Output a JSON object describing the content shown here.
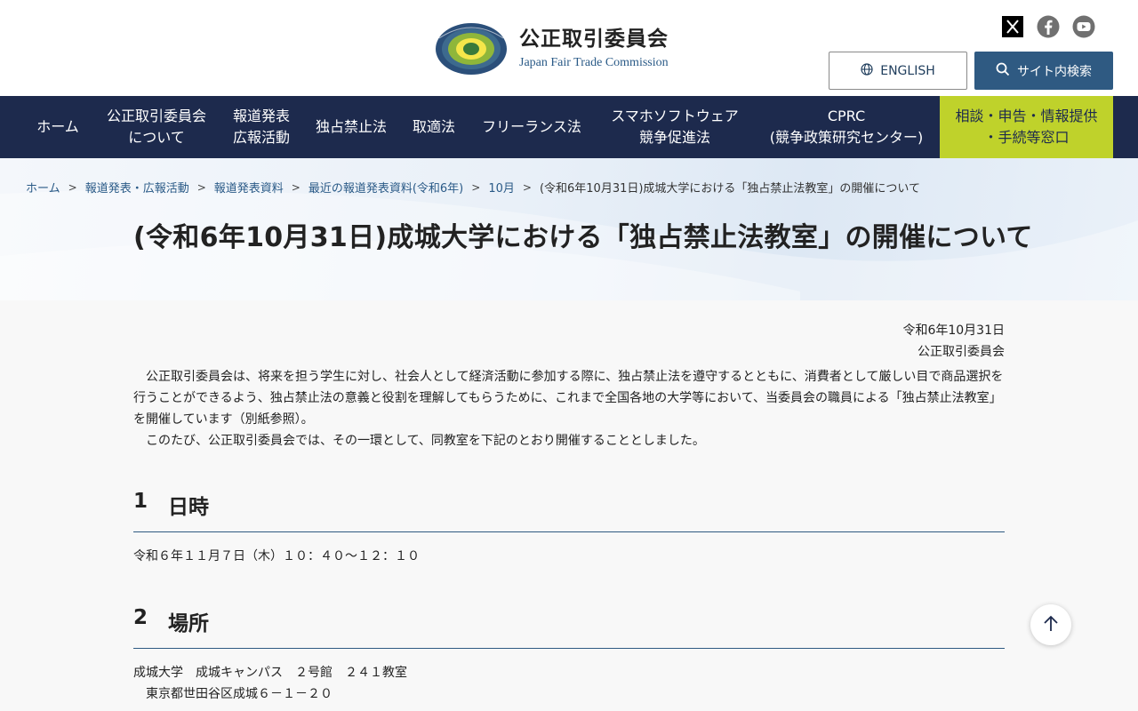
{
  "header": {
    "site_name_ja": "公正取引委員会",
    "site_name_en": "Japan Fair Trade Commission",
    "english_button": "ENGLISH",
    "search_button": "サイト内検索",
    "social": [
      "x-icon",
      "facebook-icon",
      "youtube-icon"
    ]
  },
  "nav": {
    "items": [
      {
        "label": "ホーム"
      },
      {
        "label": "公正取引委員会\nについて"
      },
      {
        "label": "報道発表\n広報活動"
      },
      {
        "label": "独占禁止法"
      },
      {
        "label": "取適法"
      },
      {
        "label": "フリーランス法"
      },
      {
        "label": "スマホソフトウェア\n競争促進法"
      },
      {
        "label": "CPRC\n(競争政策研究センター)"
      },
      {
        "label": "相談・申告・情報提供\n・手続等窓口"
      }
    ]
  },
  "breadcrumb": {
    "items": [
      "ホーム",
      "報道発表・広報活動",
      "報道発表資料",
      "最近の報道発表資料(令和6年)",
      "10月"
    ],
    "current": "(令和6年10月31日)成城大学における「独占禁止法教室」の開催について",
    "separator": ">"
  },
  "page": {
    "title": "(令和6年10月31日)成城大学における「独占禁止法教室」の開催について",
    "date": "令和6年10月31日",
    "issuer": "公正取引委員会",
    "intro_p1": "公正取引委員会は、将来を担う学生に対し、社会人として経済活動に参加する際に、独占禁止法を遵守するとともに、消費者として厳しい目で商品選択を行うことができるよう、独占禁止法の意義と役割を理解してもらうために、これまで全国各地の大学等において、当委員会の職員による「独占禁止法教室」を開催しています（別紙参照）。",
    "intro_p2": "このたび、公正取引委員会では、その一環として、同教室を下記のとおり開催することとしました。"
  },
  "sections": [
    {
      "num": "1",
      "title": "日時",
      "text": "令和６年１１月７日（木）１０：４０〜１２：１０"
    },
    {
      "num": "2",
      "title": "場所",
      "text": "成城大学　成城キャンパス　２号館　２４１教室\n　東京都世田谷区成城６－１－２０"
    }
  ],
  "colors": {
    "nav_bg": "#1d2a4d",
    "consult_bg": "#bfd22b",
    "accent_blue": "#2f5a82",
    "link": "#2a5a87"
  }
}
